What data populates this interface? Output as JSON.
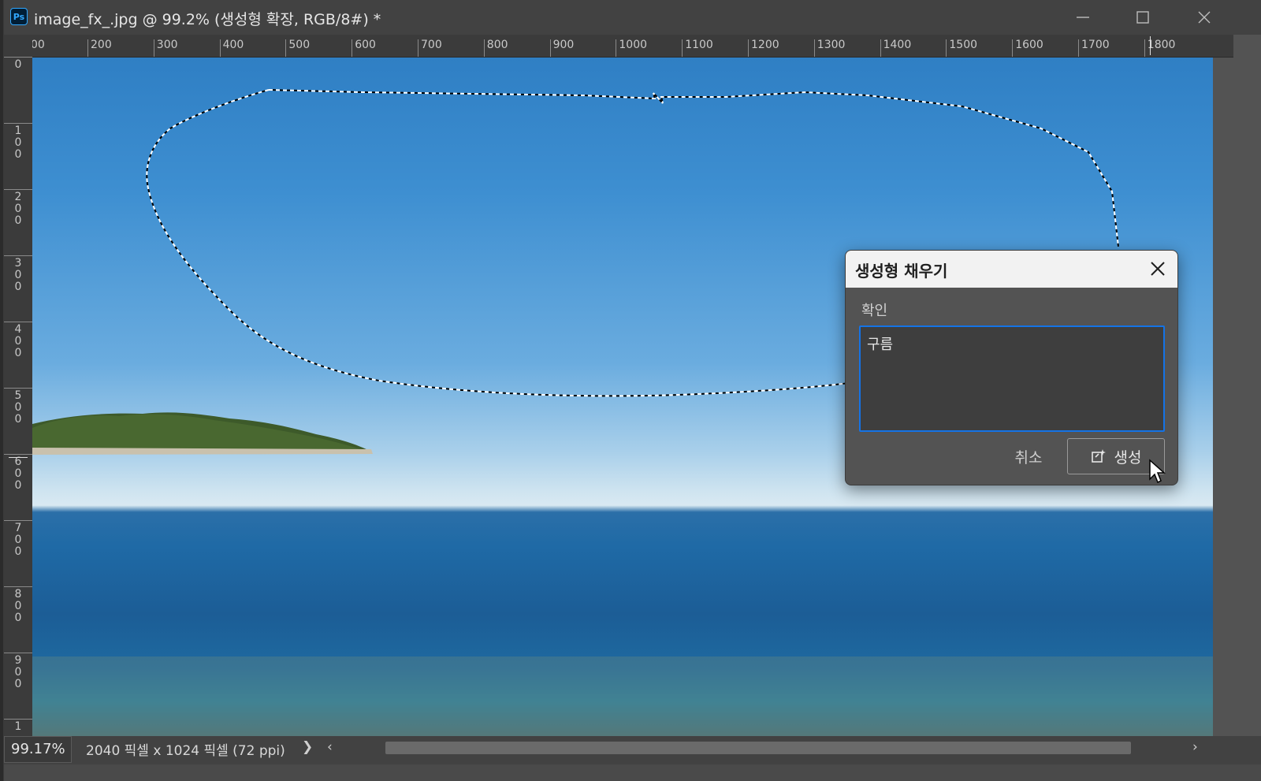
{
  "window": {
    "app_icon": "Ps",
    "title": "image_fx_.jpg @ 99.2% (생성형 확장, RGB/8#) *",
    "controls": [
      "minimize-icon",
      "maximize-icon",
      "close-icon"
    ]
  },
  "ruler_top": {
    "ticks": [
      "00",
      "200",
      "300",
      "400",
      "500",
      "600",
      "700",
      "800",
      "900",
      "1000",
      "1100",
      "1200",
      "1300",
      "1400",
      "1500",
      "1600",
      "1700",
      "1800"
    ]
  },
  "ruler_left": {
    "ticks": [
      "0",
      "100",
      "200",
      "300",
      "400",
      "500",
      "600",
      "700",
      "800",
      "900",
      "1"
    ]
  },
  "status": {
    "zoom": "99.17%",
    "doc_info": "2040 픽셀 x 1024 픽셀 (72 ppi)",
    "expand_arrow": "❯",
    "scroll_left": "‹",
    "scroll_right": "›"
  },
  "dialog": {
    "title": "생성형 채우기",
    "prompt_label": "확인",
    "prompt_value": "구름",
    "cancel_label": "취소",
    "generate_label": "생성",
    "accent": "#1473e6"
  }
}
